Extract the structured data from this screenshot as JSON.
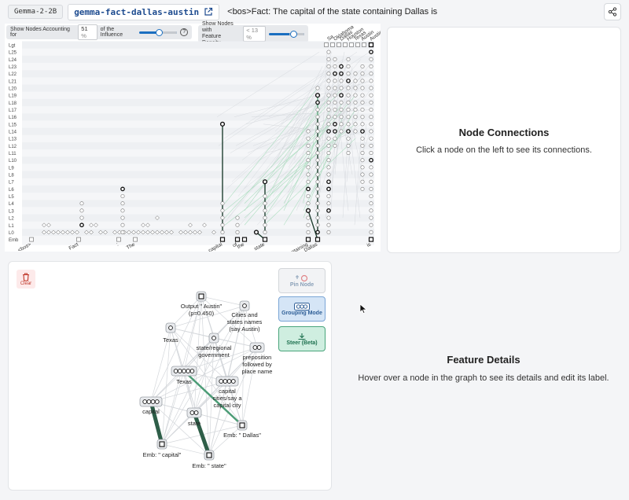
{
  "header": {
    "model": "Gemma-2-2B",
    "graph_name": "gemma-fact-dallas-austin",
    "prompt": "<bos>Fact: The capital of the state containing Dallas is"
  },
  "controls": {
    "nodes_label_pre": "Show Nodes Accounting for",
    "nodes_value": "51",
    "nodes_unit": "%",
    "nodes_label_post": "of the Influence",
    "nodes_fraction": 0.51,
    "density_label_line1": "Show Nodes with",
    "density_label_line2": "Feature Density",
    "density_value": "< 13",
    "density_unit": "%",
    "density_fraction": 0.62,
    "help_symbol": "?"
  },
  "graph": {
    "layers": [
      "Lgt",
      "L25",
      "L24",
      "L23",
      "L22",
      "L21",
      "L20",
      "L19",
      "L18",
      "L17",
      "L16",
      "L15",
      "L14",
      "L13",
      "L12",
      "L11",
      "L10",
      "L9",
      "L8",
      "L7",
      "L6",
      "L5",
      "L4",
      "L3",
      "L2",
      "L1",
      "L0",
      "Emb"
    ],
    "tokens": [
      "<bos>",
      "Fact",
      ":",
      "The",
      "capital",
      "of",
      "the",
      "state",
      "containing",
      "Dallas",
      "is"
    ],
    "top_logits": [
      "Sa",
      "Oklahoma",
      "Dallas",
      "Houston",
      "Texas",
      "Austin",
      "Austin"
    ]
  },
  "connections": {
    "title": "Node Connections",
    "subtitle": "Click a node on the left to see its connections."
  },
  "subgraph": {
    "clear_label": "Clear",
    "pin_label": "Pin Node",
    "grouping_label": "Grouping Mode",
    "steer_label": "Steer (Beta)",
    "nodes": {
      "output": "Output \" Austin\" (p=0.450)",
      "cities": "Cities and states names (say Austin)",
      "texas_top": "Texas",
      "state_gov": "state/regional government",
      "preposition": "preposition followed by place name",
      "texas_mid": "Texas",
      "capital_cities": "capital cities/say a capital city",
      "capital": "capital",
      "state": "state",
      "emb_dallas": "Emb: \" Dallas\"",
      "emb_capital": "Emb: \" capital\"",
      "emb_state": "Emb: \" state\""
    }
  },
  "feature_details": {
    "title": "Feature Details",
    "subtitle": "Hover over a node in the graph to see its details and edit its label."
  },
  "colors": {
    "accent": "#1b6fc0",
    "edge_dark": "#2e5e48",
    "edge_green": "#7fc99e",
    "clear_red": "#c0392b"
  }
}
